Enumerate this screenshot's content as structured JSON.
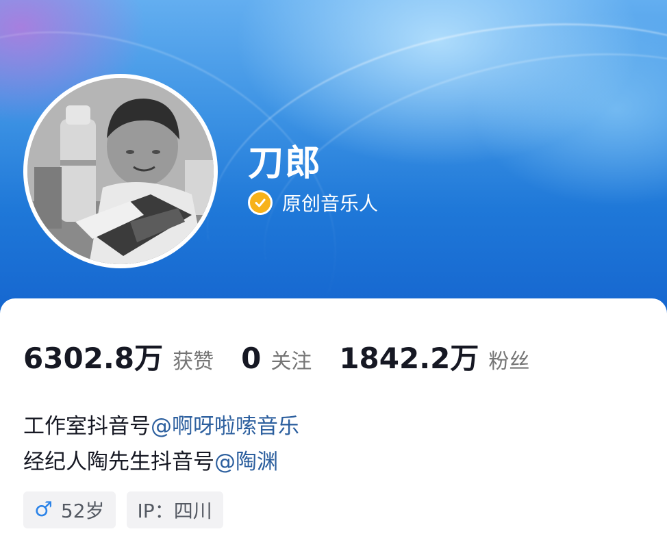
{
  "profile": {
    "name": "刀郎",
    "verification_label": "原创音乐人",
    "avatar_icon": "avatar-photo-boy-reading",
    "verified_icon": "verified-check-icon",
    "verified_color": "#f7b21a"
  },
  "stats": [
    {
      "value": "6302.8万",
      "label": "获赞"
    },
    {
      "value": "0",
      "label": "关注"
    },
    {
      "value": "1842.2万",
      "label": "粉丝"
    }
  ],
  "bio": {
    "line1_text": "工作室抖音号",
    "line1_mention": "@啊呀啦嗦音乐",
    "line2_text": "经纪人陶先生抖音号",
    "line2_mention": "@陶渊"
  },
  "tags": {
    "gender_icon": "male-icon",
    "age": "52岁",
    "ip": "IP：四川"
  },
  "colors": {
    "header_primary": "#1f78d8",
    "mention": "#2c5f9e",
    "male": "#2b83e8"
  }
}
